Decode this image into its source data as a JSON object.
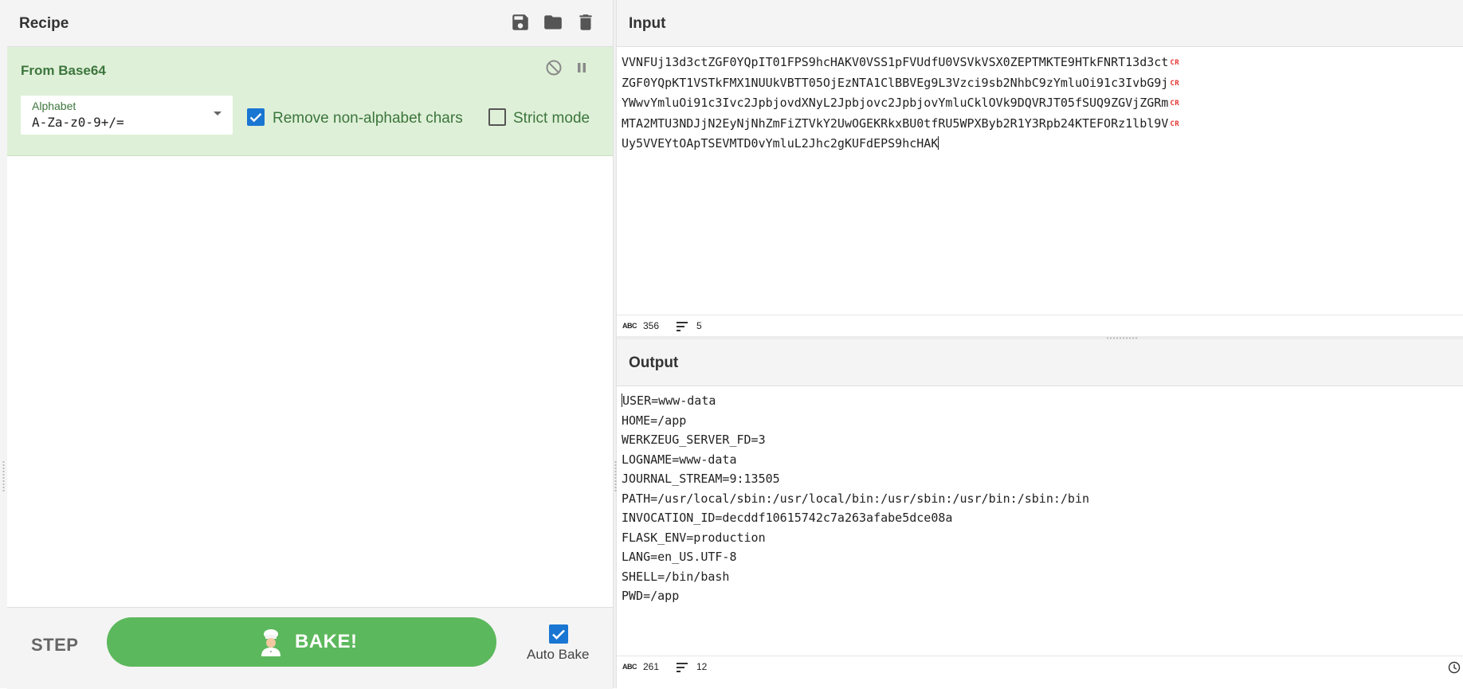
{
  "recipe": {
    "title": "Recipe",
    "operation": {
      "name": "From Base64",
      "alphabet_label": "Alphabet",
      "alphabet_value": "A-Za-z0-9+/=",
      "remove_nonalpha_label": "Remove non-alphabet chars",
      "remove_nonalpha_checked": true,
      "strict_mode_label": "Strict mode",
      "strict_mode_checked": false
    },
    "icons": [
      "save-icon",
      "folder-icon",
      "trash-icon",
      "disable-icon",
      "pause-icon"
    ]
  },
  "footer": {
    "step_label": "STEP",
    "bake_label": "BAKE!",
    "auto_bake_label": "Auto Bake",
    "auto_bake_checked": true
  },
  "input": {
    "title": "Input",
    "lines": [
      "VVNFUj13d3ctZGF0YQpIT01FPS9hcHAKV0VSS1pFVUdfU0VSVkVSX0ZEPTMKTE9HTkFNRT13d3ct",
      "ZGF0YQpKT1VSTkFMX1NUUkVBTT05OjEzNTA1ClBBVEg9L3Vzci9sb2NhbC9zYmluOi91c3IvbG9j",
      "YWwvYmluOi91c3Ivc2JpbjovdXNyL2Jpbjovc2JpbjovYmluCklOVk9DQVRJT05fSUQ9ZGVjZGRm",
      "MTA2MTU3NDJjN2EyNjNhZmFiZTVkY2UwOGEKRkxBU0tfRU5WPXByb2R1Y3Rpb24KTEFORz1lbl9V",
      "Uy5VVEYtOApTSEVMTD0vYmluL2Jhc2gKUFdEPS9hcHAK"
    ],
    "cr_marker": "CR",
    "char_count": "356",
    "line_count": "5"
  },
  "output": {
    "title": "Output",
    "lines": [
      "USER=www-data",
      "HOME=/app",
      "WERKZEUG_SERVER_FD=3",
      "LOGNAME=www-data",
      "JOURNAL_STREAM=9:13505",
      "PATH=/usr/local/sbin:/usr/local/bin:/usr/sbin:/usr/bin:/sbin:/bin",
      "INVOCATION_ID=decddf10615742c7a263afabe5dce08a",
      "FLASK_ENV=production",
      "LANG=en_US.UTF-8",
      "SHELL=/bin/bash",
      "PWD=/app"
    ],
    "char_count": "261",
    "line_count": "12"
  },
  "status": {
    "abc_label": "ABC"
  },
  "colors": {
    "operation_bg": "#dff0d8",
    "operation_text": "#3c763d",
    "bake_button": "#5cb85c",
    "checkbox": "#1976d2",
    "cr_marker": "#e53935"
  }
}
